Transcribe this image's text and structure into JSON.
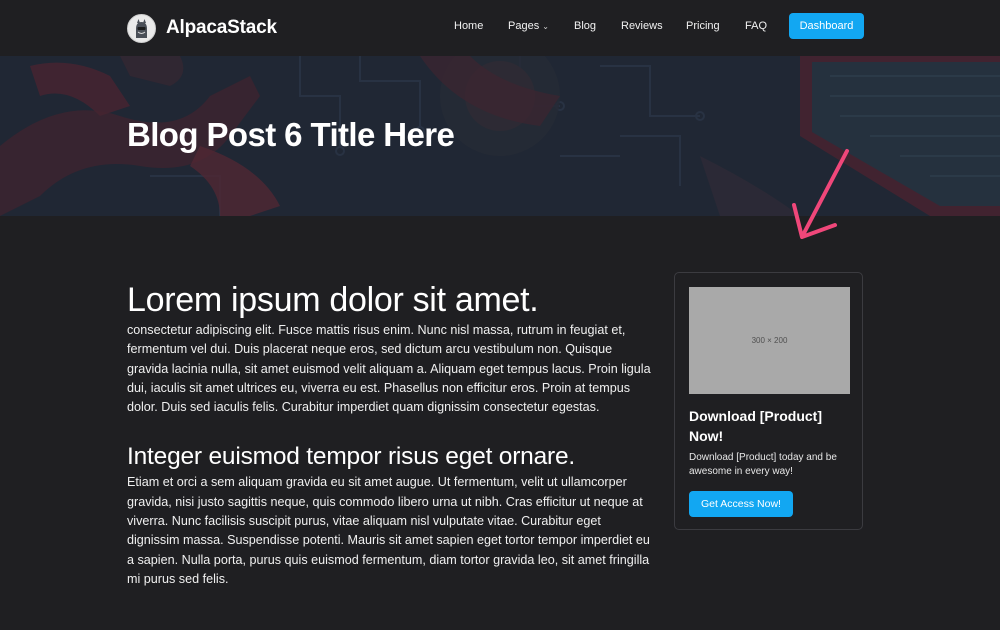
{
  "brand": {
    "name": "AlpacaStack",
    "logo_icon": "alpaca-logo-icon"
  },
  "nav": {
    "items": [
      {
        "label": "Home"
      },
      {
        "label": "Pages",
        "has_dropdown": true
      },
      {
        "label": "Blog"
      },
      {
        "label": "Reviews"
      },
      {
        "label": "Pricing"
      },
      {
        "label": "FAQ"
      }
    ],
    "dashboard_button": "Dashboard"
  },
  "hero": {
    "title": "Blog Post 6 Title Here"
  },
  "article": {
    "heading": "Lorem ipsum dolor sit amet.",
    "paragraph1": "consectetur adipiscing elit. Fusce mattis risus enim. Nunc nisl massa, rutrum in feugiat et, fermentum vel dui. Duis placerat neque eros, sed dictum arcu vestibulum non. Quisque gravida lacinia nulla, sit amet euismod velit aliquam a. Aliquam eget tempus lacus. Proin ligula dui, iaculis sit amet ultrices eu, viverra eu est. Phasellus non efficitur eros. Proin at tempus dolor. Duis sed iaculis felis. Curabitur imperdiet quam dignissim consectetur egestas.",
    "subheading": "Integer euismod tempor risus eget ornare.",
    "paragraph2": "Etiam et orci a sem aliquam gravida eu sit amet augue. Ut fermentum, velit ut ullamcorper gravida, nisi justo sagittis neque, quis commodo libero urna ut nibh. Cras efficitur ut neque at viverra. Nunc facilisis suscipit purus, vitae aliquam nisl vulputate vitae. Curabitur eget dignissim massa. Suspendisse potenti. Mauris sit amet sapien eget tortor tempor imperdiet eu a sapien. Nulla porta, purus quis euismod fermentum, diam tortor gravida leo, sit amet fringilla mi purus sed felis."
  },
  "sidebar": {
    "image_placeholder": "300 × 200",
    "title": "Download [Product] Now!",
    "text": "Download [Product] today and be awesome in every way!",
    "button": "Get Access Now!"
  },
  "colors": {
    "accent": "#12a7f2",
    "background": "#1f1f22",
    "arrow": "#f0477a"
  }
}
